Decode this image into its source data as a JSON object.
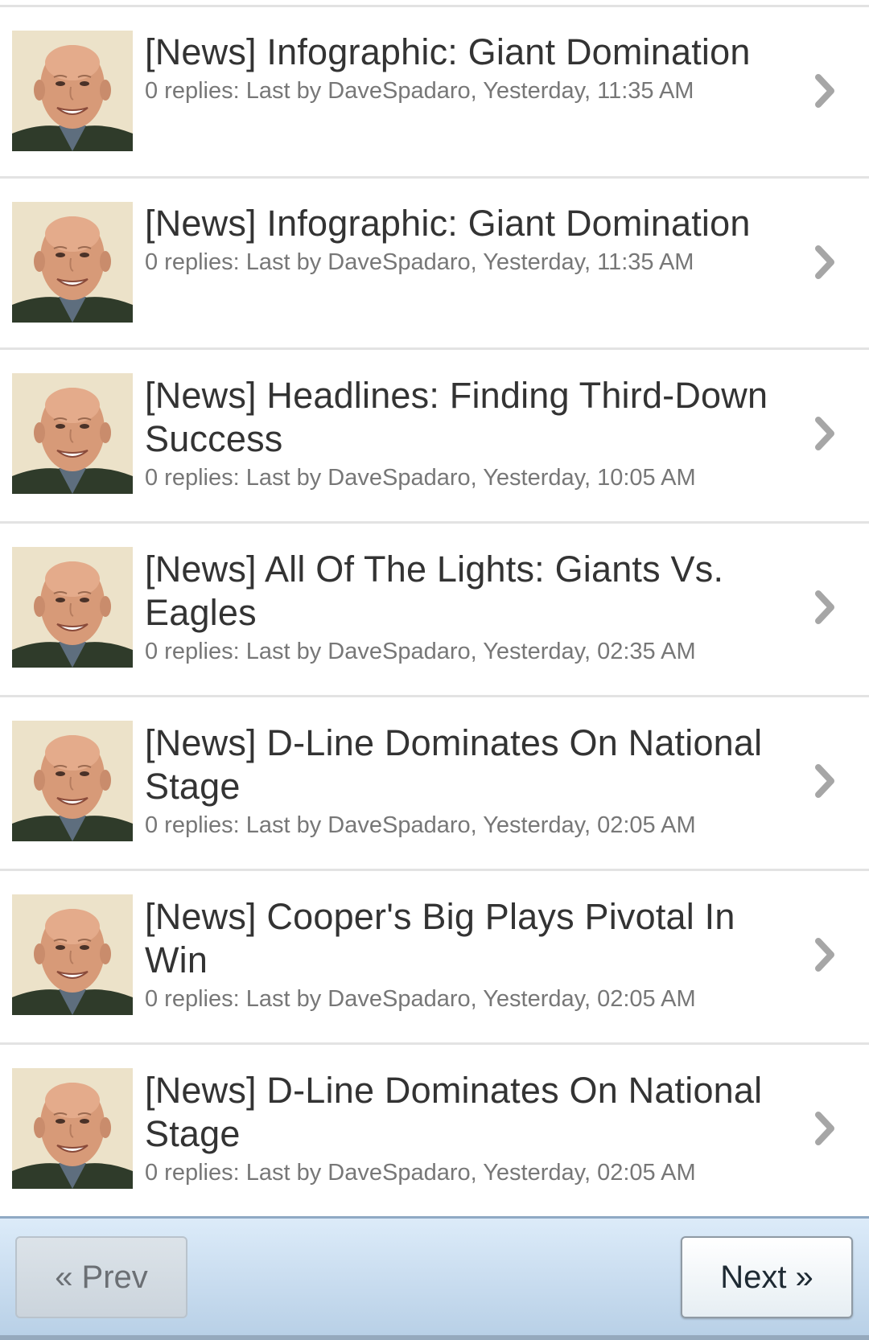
{
  "threads": [
    {
      "title": "[News] Infographic: Giant Domination",
      "meta": "0 replies: Last by DaveSpadaro, Yesterday, 11:35 AM"
    },
    {
      "title": "[News] Infographic: Giant Domination",
      "meta": "0 replies: Last by DaveSpadaro, Yesterday, 11:35 AM"
    },
    {
      "title": "[News] Headlines: Finding Third-Down Success",
      "meta": "0 replies: Last by DaveSpadaro, Yesterday, 10:05 AM"
    },
    {
      "title": "[News] All Of The Lights: Giants Vs. Eagles",
      "meta": "0 replies: Last by DaveSpadaro, Yesterday, 02:35 AM"
    },
    {
      "title": "[News] D-Line Dominates On National Stage",
      "meta": "0 replies: Last by DaveSpadaro, Yesterday, 02:05 AM"
    },
    {
      "title": "[News] Cooper's Big Plays Pivotal In Win",
      "meta": "0 replies: Last by DaveSpadaro, Yesterday, 02:05 AM"
    },
    {
      "title": "[News] D-Line Dominates On National Stage",
      "meta": "0 replies: Last by DaveSpadaro, Yesterday, 02:05 AM"
    }
  ],
  "icons": {
    "row_arrow": "chevron-right-icon",
    "avatar": "author-avatar"
  },
  "pager": {
    "prev_label": "« Prev",
    "next_label": "Next »"
  },
  "colors": {
    "title": "#333333",
    "meta": "#777777",
    "pager_bar": "#c9dcef",
    "chevron": "#a6a6a6"
  }
}
